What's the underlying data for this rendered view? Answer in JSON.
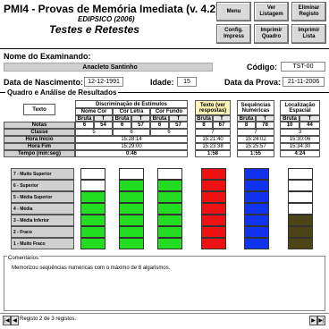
{
  "header": {
    "app_title": "PMI4 - Provas de Memória Imediata (v. 4.2)",
    "subtitle": "EDIPSICO (2006)",
    "main_title": "Testes e Retestes",
    "buttons": [
      "Menu",
      "Ver Listagem",
      "Eliminar Registo",
      "Config. Impress",
      "Imprimir Quadro",
      "Imprimir Lista"
    ]
  },
  "examinee": {
    "name_label": "Nome do Examinando:",
    "name_value": "Anacleto Santinho",
    "code_label": "Código:",
    "code_value": "TST-00",
    "birth_label": "Data de Nascimento:",
    "birth_value": "12-12-1991",
    "age_label": "Idade:",
    "age_value": "15",
    "test_date_label": "Data da Prova:",
    "test_date_value": "21-11-2006"
  },
  "results": {
    "section_title": "Quadro e Análise de Resultados",
    "texto_label": "Texto",
    "groups": {
      "discriminacao": "Discriminação de Estímulos",
      "nome_cor": "Nome Cor",
      "cor_letra": "Cor Letra",
      "cor_fundo": "Cor Fundo",
      "texto_ver": "Texto (ver respostas)",
      "sequencias": "Sequências Numéricas",
      "localizacao": "Localização Espacial"
    },
    "bruta": "Bruta",
    "t": "T",
    "row_labels": [
      "Notas",
      "Classe",
      "Hora Início",
      "Hora Fim",
      "Tempo (min:seg)"
    ],
    "notas": [
      "6",
      "54",
      "6",
      "57",
      "6",
      "57",
      "8",
      "67",
      "8",
      "78",
      "10",
      "44"
    ],
    "classe": [
      "5",
      "6",
      "6",
      "7",
      "7",
      "3"
    ],
    "hora_inicio": [
      "15:28:14",
      "15:21:40",
      "15:24:02",
      "15:30:06"
    ],
    "hora_fim": [
      "15:29:00",
      "15:23:38",
      "15:25:57",
      "15:34:30"
    ],
    "tempo": [
      "0:46",
      "1:58",
      "1:55",
      "4:24"
    ]
  },
  "levels": [
    "7 - Muito Superior",
    "6 - Superior",
    "5 - Média Superior",
    "4 - Média",
    "3 - Média Inferior",
    "2 - Fraco",
    "1 - Muito Fraco"
  ],
  "chart_data": {
    "type": "bar",
    "categories": [
      "Nome Cor",
      "Cor Letra",
      "Cor Fundo",
      "Texto",
      "Sequências Numéricas",
      "Localização Espacial"
    ],
    "values": [
      5,
      6,
      6,
      7,
      7,
      3
    ],
    "ylim": [
      0,
      7
    ],
    "colors": [
      "#22dd22",
      "#22dd22",
      "#22dd22",
      "#ee1111",
      "#1133ee",
      "#4a4418"
    ]
  },
  "comments": {
    "title": "Comentários",
    "text": "Memorizou sequências numéricas com o máximo de  8 algarismos."
  },
  "footer": {
    "record_text": "Registo 2 de 3 registos."
  }
}
